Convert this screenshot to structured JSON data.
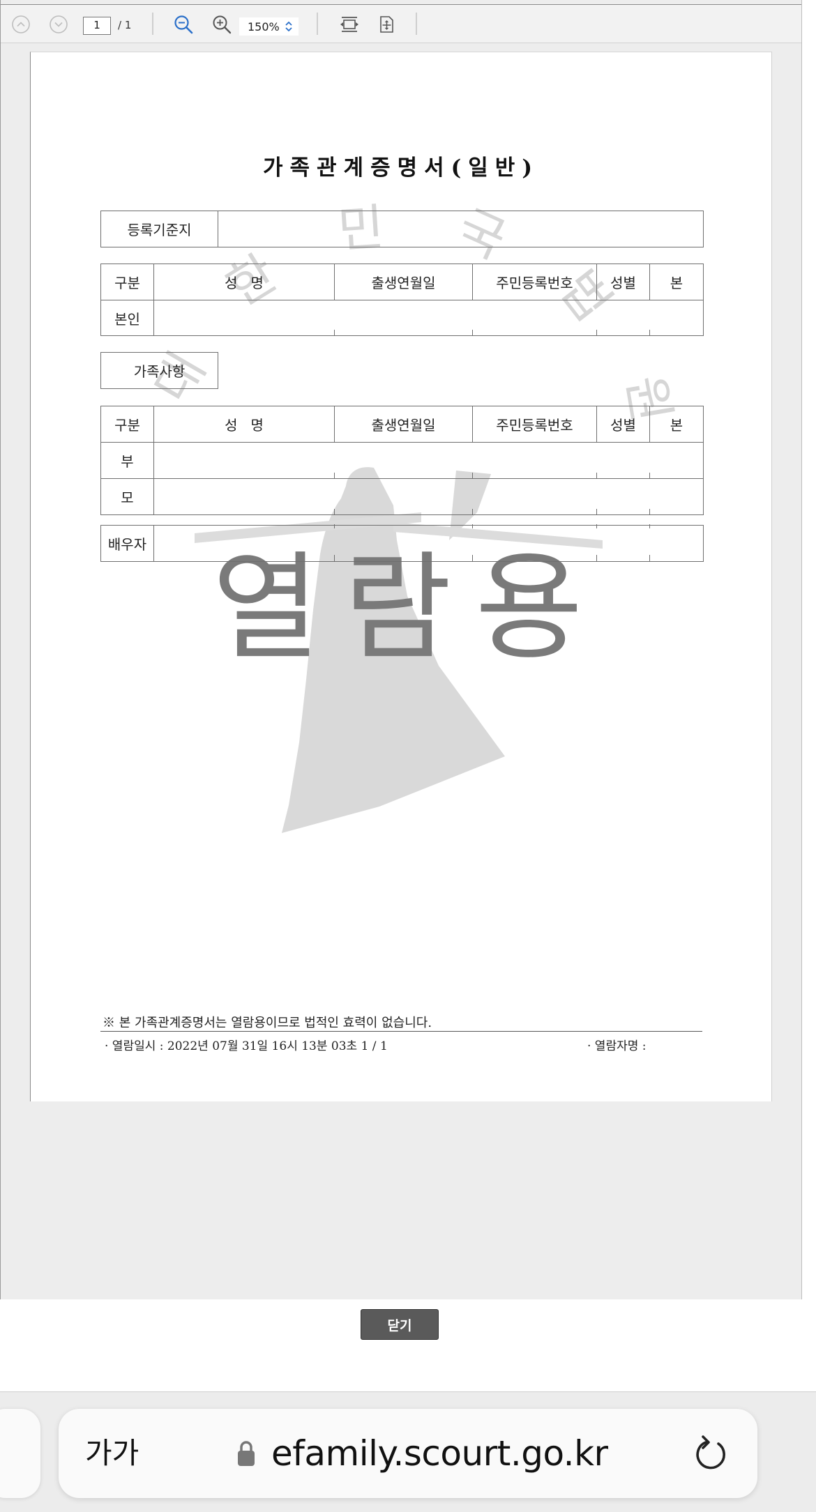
{
  "toolbar": {
    "page_current": "1",
    "page_total": "/ 1",
    "zoom": "150%"
  },
  "document": {
    "title": "가족관계증명서(일반)",
    "reg_base_label": "등록기준지",
    "header_cols": [
      "구분",
      "성   명",
      "출생연월일",
      "주민등록번호",
      "성별",
      "본"
    ],
    "self_row_label": "본인",
    "family_section_label": "가족사항",
    "family_rows": [
      "부",
      "모"
    ],
    "spouse_label": "배우자",
    "watermark_text": "열람용",
    "watermark_seal_text": "대한민국법원",
    "note": "※ 본 가족관계증명서는 열람용이므로 법적인 효력이 없습니다.",
    "view_date": "· 열람일시 : 2022년 07월 31일 16시 13분 03초   1 / 1",
    "viewer_label": "· 열람자명 :"
  },
  "close_button_label": "닫기",
  "browser": {
    "text_size_label": "가가",
    "url": "efamily.scourt.go.kr"
  }
}
